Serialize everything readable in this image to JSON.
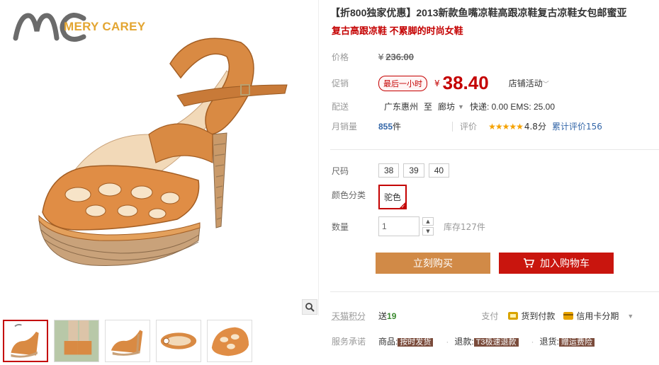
{
  "brand": {
    "logo_text": "MERY CAREY"
  },
  "product": {
    "title": "【折800独家优惠】2013新款鱼嘴凉鞋高跟凉鞋复古凉鞋女包邮蜜亚",
    "subtitle": "复古高跟凉鞋 不累脚的时尚女鞋"
  },
  "price": {
    "label": "价格",
    "currency": "¥",
    "original": "236.00"
  },
  "promo": {
    "label": "促销",
    "tag": "最后一小时",
    "currency": "¥",
    "price": "38.40",
    "shop_activity": "店铺活动"
  },
  "shipping": {
    "label": "配送",
    "from": "广东惠州",
    "to_word": "至",
    "to": "廊坊",
    "fees": "快递: 0.00 EMS: 25.00"
  },
  "sales": {
    "label": "月销量",
    "count": "855",
    "unit": "件",
    "rating_label": "评价",
    "stars": "★★★★★",
    "score": "4.8分",
    "reviews_link": "累计评价156"
  },
  "options": {
    "size_label": "尺码",
    "sizes": [
      "38",
      "39",
      "40"
    ],
    "color_label": "颜色分类",
    "color": "驼色",
    "qty_label": "数量",
    "qty_value": "1",
    "stock": "库存127件"
  },
  "buttons": {
    "buy_now": "立刻购买",
    "add_to_cart": "加入购物车"
  },
  "footer": {
    "points_label": "天猫积分",
    "points_prefix": "送",
    "points_value": "19",
    "pay_label": "支付",
    "pay_cod": "货到付款",
    "pay_card": "信用卡分期",
    "service_label": "服务承诺",
    "svc1_prefix": "商品:",
    "svc1_tag": "按时发货",
    "svc2_prefix": "退款:",
    "svc2_tag": "T3极速退款",
    "svc3_prefix": "退货:",
    "svc3_tag": "赠运费险"
  },
  "colors": {
    "accent_red": "#c40000",
    "buy_button": "#d18a47",
    "cart_button": "#c9150e",
    "logo_gold": "#e3a531",
    "link_blue": "#3366a8"
  },
  "icons": [
    "zoom-icon",
    "cart-icon",
    "cod-icon",
    "credit-card-icon",
    "check-icon",
    "chevron-down-icon"
  ]
}
